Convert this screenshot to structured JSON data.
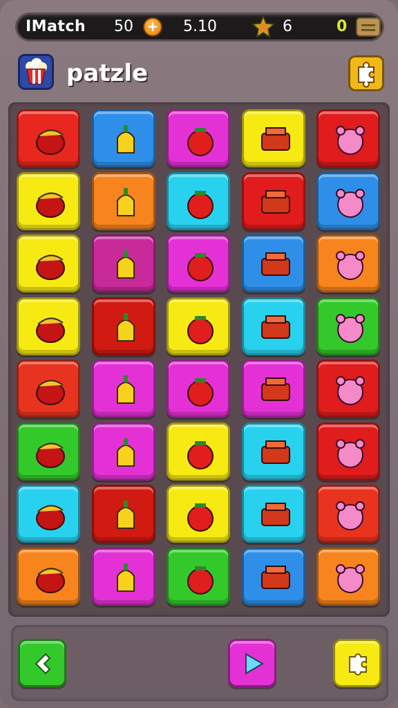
{
  "header": {
    "app_name": "IMatch",
    "score": "50",
    "coin_symbol": "+",
    "timer": "5.10",
    "stars": "6",
    "bank": "0"
  },
  "title": "patzle",
  "colors": {
    "red": "#e8281e",
    "blue": "#2f8fe8",
    "magenta": "#e431d6",
    "yellow": "#f7ea12",
    "orange": "#f7841c",
    "cyan": "#28d2ee",
    "green": "#34c92a",
    "darkred": "#d11a12"
  },
  "board": {
    "rows": 8,
    "cols": 5,
    "tiles": [
      {
        "color": "#e8281e",
        "icon": "banana-icon"
      },
      {
        "color": "#2f8fe8",
        "icon": "bell-pepper-icon"
      },
      {
        "color": "#e431d6",
        "icon": "tomato-icon"
      },
      {
        "color": "#f7ea12",
        "icon": "toolbox-icon"
      },
      {
        "color": "#e11c1c",
        "icon": "bear-face-icon"
      },
      {
        "color": "#f7ea12",
        "icon": "pig-face-icon"
      },
      {
        "color": "#f7841c",
        "icon": "caterpillar-icon"
      },
      {
        "color": "#28d2ee",
        "icon": "orange-fish-icon"
      },
      {
        "color": "#e11c1c",
        "icon": "blue-bird-icon"
      },
      {
        "color": "#2f8fe8",
        "icon": "candy-cap-icon"
      },
      {
        "color": "#f7ea12",
        "icon": "sheep-face-icon"
      },
      {
        "color": "#c92a9a",
        "icon": "flag-icon"
      },
      {
        "color": "#e431d6",
        "icon": "purple-candy-icon"
      },
      {
        "color": "#2f8fe8",
        "icon": "green-bulb-icon"
      },
      {
        "color": "#f7841c",
        "icon": "striped-cap-icon"
      },
      {
        "color": "#f7ea12",
        "icon": "lemon-icon"
      },
      {
        "color": "#d11a12",
        "icon": "pot-icon"
      },
      {
        "color": "#f7ea12",
        "icon": "blue-bottle-icon"
      },
      {
        "color": "#28d2ee",
        "icon": "comma-icon"
      },
      {
        "color": "#34c92a",
        "icon": "cucumber-icon"
      },
      {
        "color": "#e8341e",
        "icon": "crossed-sticks-icon"
      },
      {
        "color": "#e431d6",
        "icon": "red-cap-icon"
      },
      {
        "color": "#e431d6",
        "icon": "sun-icon"
      },
      {
        "color": "#e431d6",
        "icon": "pencil-box-icon"
      },
      {
        "color": "#e11c1c",
        "icon": "ring-icon"
      },
      {
        "color": "#34c92a",
        "icon": "orange-ball-icon"
      },
      {
        "color": "#e431d6",
        "icon": "blue-gear-icon"
      },
      {
        "color": "#f7ea12",
        "icon": "donut-icon"
      },
      {
        "color": "#28d2ee",
        "icon": "pink-donut-icon"
      },
      {
        "color": "#e11c1c",
        "icon": "pink-bear-icon"
      },
      {
        "color": "#28d2ee",
        "icon": "green-fruit-icon"
      },
      {
        "color": "#d11a12",
        "icon": "salad-bowl-icon"
      },
      {
        "color": "#f7ea12",
        "icon": "purple-dome-icon"
      },
      {
        "color": "#28d2ee",
        "icon": "red-candy-icon"
      },
      {
        "color": "#e8341e",
        "icon": "green-flower-icon"
      },
      {
        "color": "#f7841c",
        "icon": "cup-icon"
      },
      {
        "color": "#e431d6",
        "icon": "carrot-icon"
      },
      {
        "color": "#34c92a",
        "icon": "cabbage-knife-icon"
      },
      {
        "color": "#2f8fe8",
        "icon": "red-pot-icon"
      },
      {
        "color": "#f7841c",
        "icon": "orange-flower-icon"
      }
    ]
  },
  "footer": {
    "back_color": "#34c92a",
    "play_color": "#e431d6",
    "puzzle_color": "#f7ea12"
  }
}
